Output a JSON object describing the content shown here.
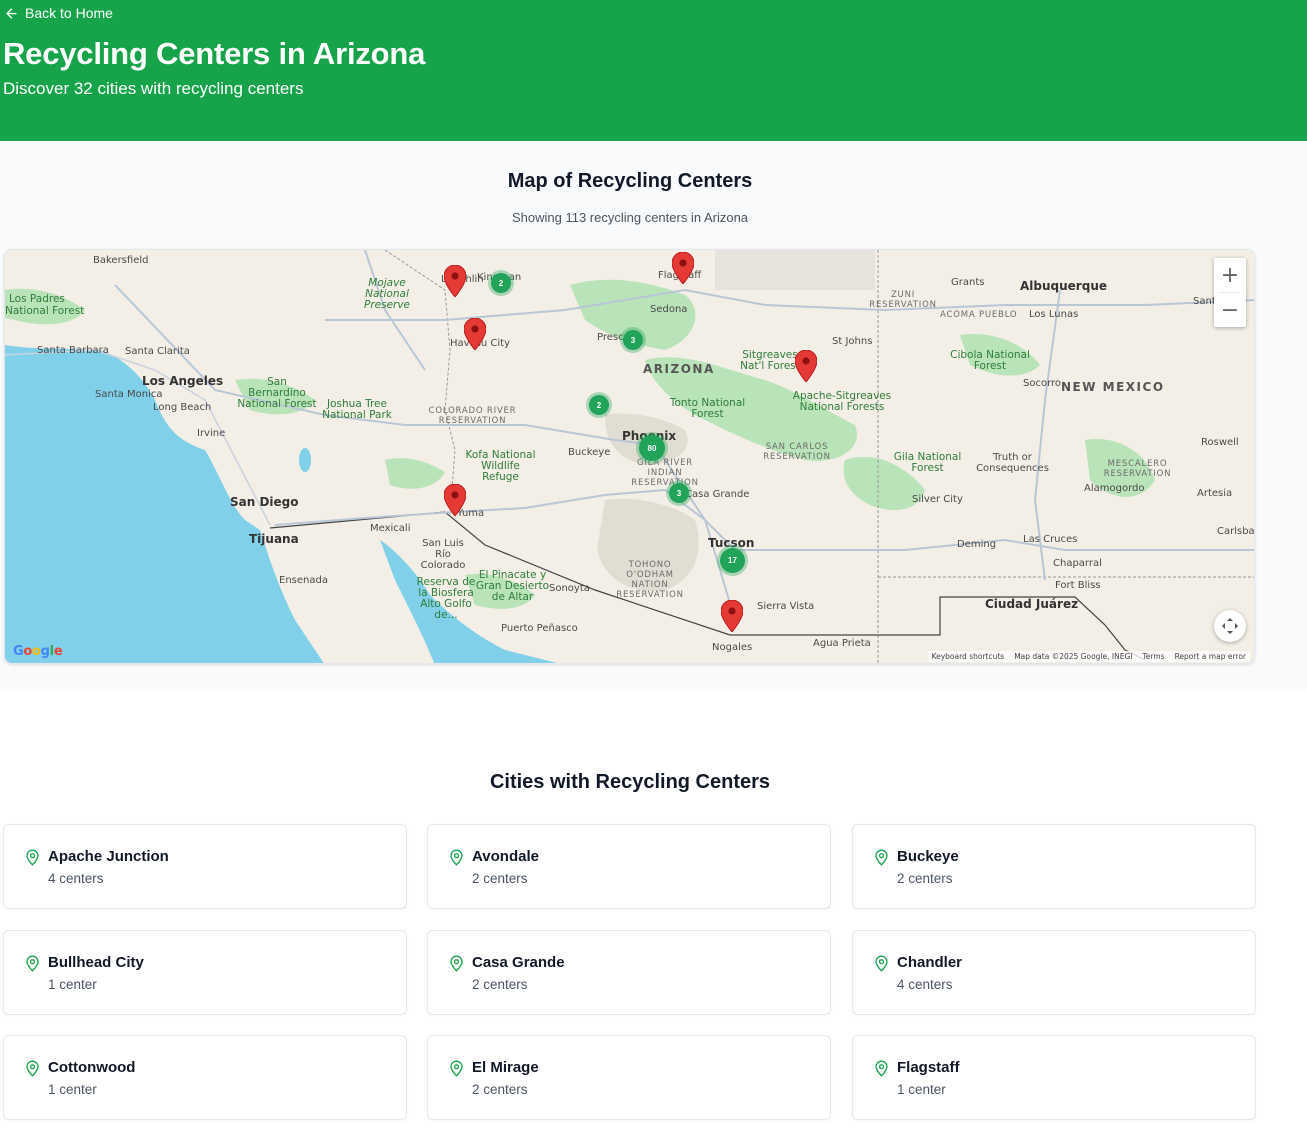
{
  "header": {
    "back_label": "Back to Home",
    "title": "Recycling Centers in Arizona",
    "subtitle": "Discover 32 cities with recycling centers"
  },
  "map_section": {
    "title": "Map of Recycling Centers",
    "subtitle": "Showing 113 recycling centers in Arizona",
    "controls": {
      "zoom_in": "+",
      "zoom_out": "−"
    },
    "attribution": {
      "logo": "Google",
      "keyboard": "Keyboard shortcuts",
      "map_data": "Map data ©2025 Google, INEGI",
      "terms": "Terms",
      "report": "Report a map error"
    },
    "clusters": [
      "2",
      "3",
      "2",
      "80",
      "3",
      "17"
    ],
    "place_labels": {
      "bakersfield": "Bakersfield",
      "los_padres": "Los Padres",
      "national_forest_lp": "National Forest",
      "santa_barbara": "Santa Barbara",
      "santa_clarita": "Santa Clarita",
      "los_angeles": "Los Angeles",
      "santa_monica": "Santa Monica",
      "long_beach": "Long Beach",
      "irvine": "Irvine",
      "san_bernardino": "San Bernardino National Forest",
      "joshua_tree": "Joshua Tree National Park",
      "mojave": "Mojave National Preserve",
      "colorado_river": "COLORADO RIVER RESERVATION",
      "san_diego": "San Diego",
      "tijuana": "Tijuana",
      "mexicali": "Mexicali",
      "ensenada": "Ensenada",
      "san_luis": "San Luis Río Colorado",
      "reserva": "Reserva de la Biosfera Alto Golfo de...",
      "pinacate": "El Pinacate y Gran Desierto de Altar",
      "sonoyta": "Sonoyta",
      "puerto_penasco": "Puerto Peñasco",
      "kofa": "Kofa National Wildlife Refuge",
      "yuma": "Yuma",
      "buckeye": "Buckeye",
      "laughlin": "Laughlin",
      "kingman": "Kingman",
      "havasu": "Havasu City",
      "prescott": "Prescott",
      "flagstaff": "Flagstaff",
      "sedona": "Sedona",
      "arizona": "ARIZONA",
      "tonto": "Tonto National Forest",
      "phoenix": "Phoenix",
      "gila_river": "GILA RIVER INDIAN RESERVATION",
      "casa_grande": "Casa Grande",
      "tohono": "TOHONO O'ODHAM NATION RESERVATION",
      "tucson": "Tucson",
      "nogales": "Nogales",
      "sierra_vista": "Sierra Vista",
      "agua_prieta": "Agua Prieta",
      "sitgreaves": "Sitgreaves Nat'l Forest",
      "apache_sitgreaves": "Apache-Sitgreaves National Forests",
      "st_johns": "St Johns",
      "san_carlos": "SAN CARLOS RESERVATION",
      "gila_nf": "Gila National Forest",
      "silver_city": "Silver City",
      "grants": "Grants",
      "zuni": "ZUNI RESERVATION",
      "acoma": "ACOMA PUEBLO",
      "albuquerque": "Albuquerque",
      "los_lunas": "Los Lunas",
      "santa_fe": "Santa F",
      "cibola": "Cibola National Forest",
      "socorro": "Socorro",
      "new_mexico": "NEW MEXICO",
      "roswell": "Roswell",
      "truth": "Truth or Consequences",
      "mescalero": "MESCALERO RESERVATION",
      "alamogordo": "Alamogordo",
      "artesia": "Artesia",
      "carlsbad": "Carlsba",
      "deming": "Deming",
      "las_cruces": "Las Cruces",
      "chaparral": "Chaparral",
      "fort_bliss": "Fort Bliss",
      "ciudad_juarez": "Ciudad Juárez"
    }
  },
  "cities_section": {
    "title": "Cities with Recycling Centers",
    "cities": [
      {
        "name": "Apache Junction",
        "count": "4 centers"
      },
      {
        "name": "Avondale",
        "count": "2 centers"
      },
      {
        "name": "Buckeye",
        "count": "2 centers"
      },
      {
        "name": "Bullhead City",
        "count": "1 center"
      },
      {
        "name": "Casa Grande",
        "count": "2 centers"
      },
      {
        "name": "Chandler",
        "count": "4 centers"
      },
      {
        "name": "Cottonwood",
        "count": "1 center"
      },
      {
        "name": "El Mirage",
        "count": "2 centers"
      },
      {
        "name": "Flagstaff",
        "count": "1 center"
      }
    ]
  },
  "colors": {
    "brand": "#16a34a",
    "cluster": "#22a35a",
    "pin": "#e53935",
    "water": "#7fd0e8"
  }
}
